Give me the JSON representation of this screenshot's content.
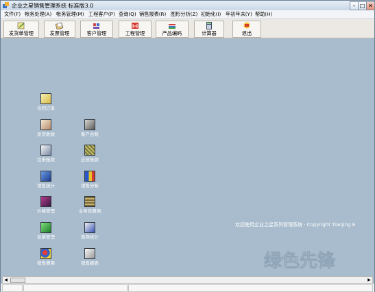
{
  "window": {
    "title": "企业之星销售管理系统  标准版3.0",
    "minimize_glyph": "–",
    "maximize_glyph": "□",
    "close_glyph": "✕"
  },
  "menu": {
    "items": [
      {
        "label": "文件(F)"
      },
      {
        "label": "帐务处理(A)"
      },
      {
        "label": "帐务管理(M)"
      },
      {
        "label": "工程客户(P)"
      },
      {
        "label": "查询(Q)"
      },
      {
        "label": "销售报表(R)"
      },
      {
        "label": "图形分析(Z)"
      },
      {
        "label": "初始化(I)"
      },
      {
        "label": "年初年末(Y)"
      },
      {
        "label": "帮助(H)"
      }
    ]
  },
  "toolbar": {
    "buttons": [
      {
        "label": "发货单管理",
        "icon": "pencil-icon"
      },
      {
        "label": "发票管理",
        "icon": "invoice-icon"
      },
      {
        "label": "客户管理",
        "icon": "people-icon"
      },
      {
        "label": "工程管理",
        "icon": "engineering-icon"
      },
      {
        "label": "产品编码",
        "icon": "books-icon"
      },
      {
        "label": "计算器",
        "icon": "calculator-icon"
      },
      {
        "label": "退出",
        "icon": "exit-icon"
      }
    ]
  },
  "desktop": {
    "items": [
      {
        "label": "合同订单",
        "icon": "contract-icon"
      },
      {
        "label": "发货收款",
        "icon": "delivery-icon"
      },
      {
        "label": "客户台账",
        "icon": "ledger-icon"
      },
      {
        "label": "往来账款",
        "icon": "accounts-icon"
      },
      {
        "label": "应收账款",
        "icon": "receivable-icon"
      },
      {
        "label": "销售统计",
        "icon": "statistics-icon"
      },
      {
        "label": "销售分析",
        "icon": "analysis-icon"
      },
      {
        "label": "价格管理",
        "icon": "price-icon"
      },
      {
        "label": "业务员费用",
        "icon": "salesman-icon"
      },
      {
        "label": "发票管理",
        "icon": "invoice-doc-icon"
      },
      {
        "label": "库存统计",
        "icon": "inventory-icon"
      },
      {
        "label": "销售费用",
        "icon": "cost-icon"
      },
      {
        "label": "销售报表",
        "icon": "report-icon"
      }
    ]
  },
  "marquee": "欢迎使用企业之星系列管理系统 · Copyright Tianjing E",
  "watermark": "绿色先锋",
  "colors": {
    "desktop_bg": "#a9bccd",
    "toolbar_bg": "#ece9e4",
    "title_text": "#000000",
    "label_text": "#ffffff"
  }
}
